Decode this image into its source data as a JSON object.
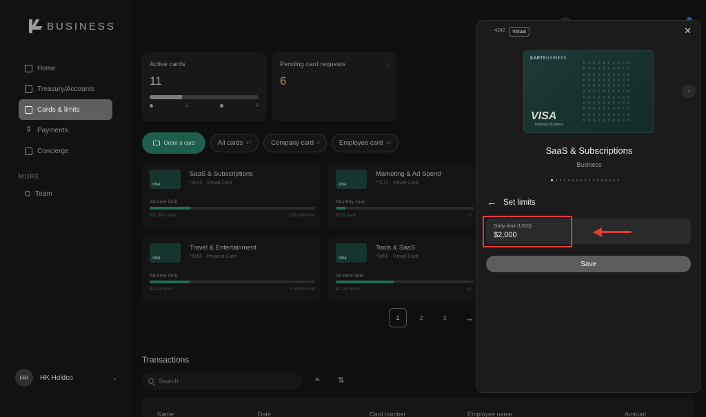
{
  "brand": {
    "name": "BUSINESS"
  },
  "sidebar": {
    "items": [
      {
        "label": "Home",
        "icon": "home-icon"
      },
      {
        "label": "Treasury/Accounts",
        "icon": "bank-icon"
      },
      {
        "label": "Cards & limits",
        "icon": "card-icon"
      },
      {
        "label": "Payments",
        "icon": "transfer-icon"
      },
      {
        "label": "Concierge",
        "icon": "building-icon"
      }
    ],
    "more_label": "MORE",
    "team_label": "Team",
    "user": {
      "initials": "HH",
      "name": "HK Holdco"
    }
  },
  "stats": {
    "active": {
      "label": "Active cards",
      "value": "11",
      "progress": 0.3,
      "legend_a": "3",
      "legend_b": "8"
    },
    "pending": {
      "label": "Pending card requests",
      "value": "6"
    }
  },
  "filters": {
    "order_label": "Order a card",
    "chips": [
      {
        "label": "All cards",
        "count": "17"
      },
      {
        "label": "Company card",
        "count": "3"
      },
      {
        "label": "Employee card",
        "count": "14"
      }
    ]
  },
  "cards": [
    {
      "title": "SaaS & Subscriptions",
      "sub": "*4242 · Virtual Card",
      "limit": "All-time limit",
      "spent": "$12,500 spent",
      "of": "of $50,000 limit",
      "progress": 0.25
    },
    {
      "title": "Marketing & Ad Spend",
      "sub": "*7171 · Virtual Card",
      "limit": "Monthly limit",
      "spent": "$700 spent",
      "of": "of",
      "progress": 0.07
    },
    {
      "title": "Travel & Entertainment",
      "sub": "*5555 · Physical Card",
      "limit": "All-time limit",
      "spent": "$1,200 spent",
      "of": "of $5,000 limit",
      "progress": 0.24
    },
    {
      "title": "Tools & SaaS",
      "sub": "*0456 · Virtual Card",
      "limit": "All-time limit",
      "spent": "$2,100 spent",
      "of": "of",
      "progress": 0.42
    }
  ],
  "pager": {
    "pages": [
      "1",
      "2",
      "3"
    ],
    "current": "1"
  },
  "transactions": {
    "title": "Transactions",
    "search_placeholder": "Search",
    "columns": [
      "Name",
      "Date",
      "Card number",
      "Employee name",
      "Amount"
    ]
  },
  "panel": {
    "card_number": "···· 4242",
    "badge": "Virtual",
    "card_brand_a": "KART",
    "card_brand_b": "BUSINESS",
    "network": "VISA",
    "tier": "Platinum Business",
    "card_name": "SaaS & Subscriptions",
    "card_type": "Business",
    "dots_total": 17,
    "dots_active": 0,
    "section_title": "Set limits",
    "field_label": "Daily limit (USD)",
    "field_value": "$2,000",
    "save_label": "Save"
  },
  "colors": {
    "accent_green": "#1e5e4c",
    "highlight_red": "#e53935"
  }
}
